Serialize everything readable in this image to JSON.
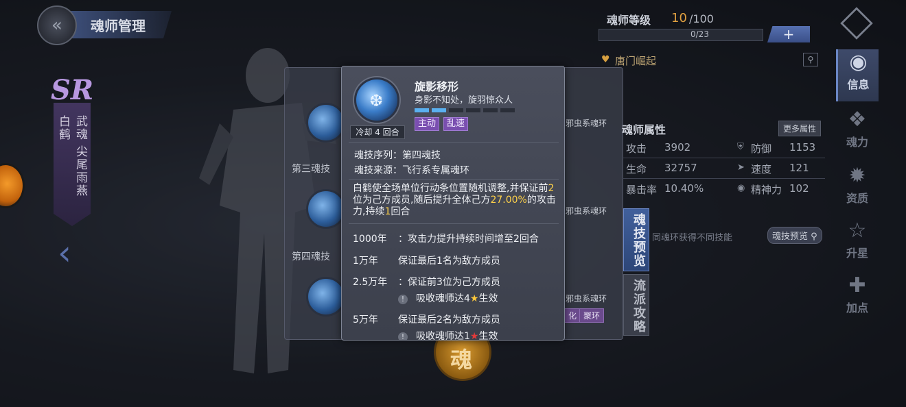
{
  "header": {
    "title": "魂师管理"
  },
  "character": {
    "rank_badge": "SR",
    "name": "白鹤",
    "type": "武魂",
    "spirit": "尖尾雨燕"
  },
  "skill_panel": {
    "labels": [
      "第三魂技",
      "第四魂技"
    ],
    "schools": [
      "邪虫系魂环",
      "邪虫系魂环",
      "邪虫系魂环"
    ],
    "tag_partial": "化",
    "tag_juhuan": "聚环"
  },
  "right_panel": {
    "rank_label": "魂师等级",
    "rank_value": "10",
    "rank_max": "/100",
    "exp_text": "0/23",
    "plus_label": "+",
    "clan_name": "唐门崛起",
    "attr_title": "魂师属性",
    "more_attr": "更多属性",
    "stats": [
      {
        "label": "攻击",
        "value": "3902"
      },
      {
        "label": "防御",
        "value": "1153"
      },
      {
        "label": "生命",
        "value": "32757"
      },
      {
        "label": "速度",
        "value": "121"
      },
      {
        "label": "暴击率",
        "value": "10.40%"
      },
      {
        "label": "精神力",
        "value": "102"
      }
    ],
    "preview_tab": "魂技预览",
    "strategy_tab": "流派攻略",
    "ring_hint": "同魂环获得不同技能",
    "preview_button": "魂技预览"
  },
  "nav": {
    "items": [
      {
        "label": "信息",
        "icon": "info-icon",
        "active": true
      },
      {
        "label": "魂力",
        "icon": "soul-power-icon"
      },
      {
        "label": "资质",
        "icon": "aptitude-icon"
      },
      {
        "label": "升星",
        "icon": "star-icon"
      },
      {
        "label": "加点",
        "icon": "add-point-icon"
      }
    ]
  },
  "seal": {
    "text": "魂"
  },
  "popup": {
    "skill_name": "旋影移形",
    "subtitle": "身影不知处，旋羽惊众人",
    "cooldown": "冷却 4 回合",
    "level_bars_total": 6,
    "level_bars_on": 2,
    "tags": [
      "主动",
      "乱速"
    ],
    "sequence_label": "魂技序列：",
    "sequence_value": "第四魂技",
    "source_label": "魂技来源：",
    "source_value": "飞行系专属魂环",
    "desc_parts": {
      "p1": "白鹤使全场单位行动条位置随机调整,并保证前",
      "n1": "2",
      "p2": "位为己方成员,随后提升全体己方",
      "n2": "27.00%",
      "p3": "的攻击力,持续",
      "n3": "1",
      "p4": "回合"
    },
    "upgrades": [
      {
        "year": "1000年",
        "text": "：攻击力提升持续时间增至2回合"
      },
      {
        "year": "1万年",
        "text": "保证最后1名为敌方成员"
      },
      {
        "year": "2.5万年",
        "text": "：保证前3位为己方成员",
        "cond_pre": "吸收魂师达4",
        "cond_post": "生效"
      },
      {
        "year": "5万年",
        "text": "保证最后2名为敌方成员",
        "cond_pre": "吸收魂师达1",
        "cond_post": "生效"
      }
    ],
    "exclaim": "!",
    "star_glyph": "★"
  },
  "colors": {
    "accent_blue": "#5ab0f0",
    "tag_purple": "#7a4fb0",
    "highlight_yellow": "#ffd24a",
    "rank_orange": "#e0a040"
  }
}
